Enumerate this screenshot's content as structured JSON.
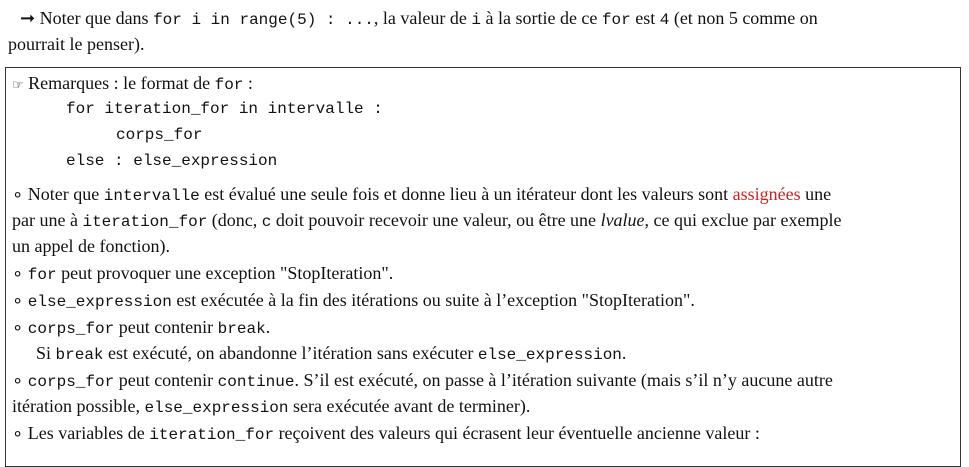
{
  "intro": {
    "arrow": "➞",
    "t1": "Noter que dans",
    "c1": "for i in range(5) : ...",
    "t2": ", la valeur de",
    "c2": "i",
    "t3": "à la sortie de ce",
    "c3": "for",
    "t4": "est",
    "c4": "4",
    "t5": "(et non 5 comme on",
    "t6": "pourrait le penser)."
  },
  "box": {
    "hand": "☞",
    "h1": "Remarques : le format de",
    "hc": "for",
    "h2": ":",
    "code1": "for iteration_for in intervalle :",
    "code2": "corps_for",
    "code3": "else : else_expression",
    "b": "∘",
    "r1a": "Noter que",
    "r1c1": "intervalle",
    "r1b": "est évalué une seule fois et donne lieu à un itérateur dont les valeurs sont",
    "r1red": "assignées",
    "r1d": "une",
    "r2a": "par une à",
    "r2c1": "iteration_for",
    "r2b": "(donc,",
    "r2c2": "c",
    "r2c": "doit pouvoir recevoir une valeur, ou être une",
    "r2it": "lvalue",
    "r2d": ", ce qui exclue par exemple",
    "r3": "un appel de fonction).",
    "r4c": "for",
    "r4": "peut provoquer une exception \"StopIteration\".",
    "r5c": "else_expression",
    "r5": "est exécutée à la fin des itérations ou suite à l’exception \"StopIteration\".",
    "r6c1": "corps_for",
    "r6a": "peut contenir",
    "r6c2": "break",
    "r6b": ".",
    "r7a": "Si",
    "r7c1": "break",
    "r7b": "est exécuté, on abandonne l’itération sans exécuter",
    "r7c2": "else_expression",
    "r7d": ".",
    "r8c1": "corps_for",
    "r8a": "peut contenir",
    "r8c2": "continue",
    "r8b": ". S’il est exécuté, on passe à l’itération suivante (mais s’il n’y aucune autre",
    "r9a": "itération possible,",
    "r9c": "else_expression",
    "r9b": "sera exécutée avant de terminer).",
    "r10a": "Les variables de",
    "r10c": "iteration_for",
    "r10b": "reçoivent des valeurs qui écrasent leur éventuelle ancienne valeur :"
  }
}
